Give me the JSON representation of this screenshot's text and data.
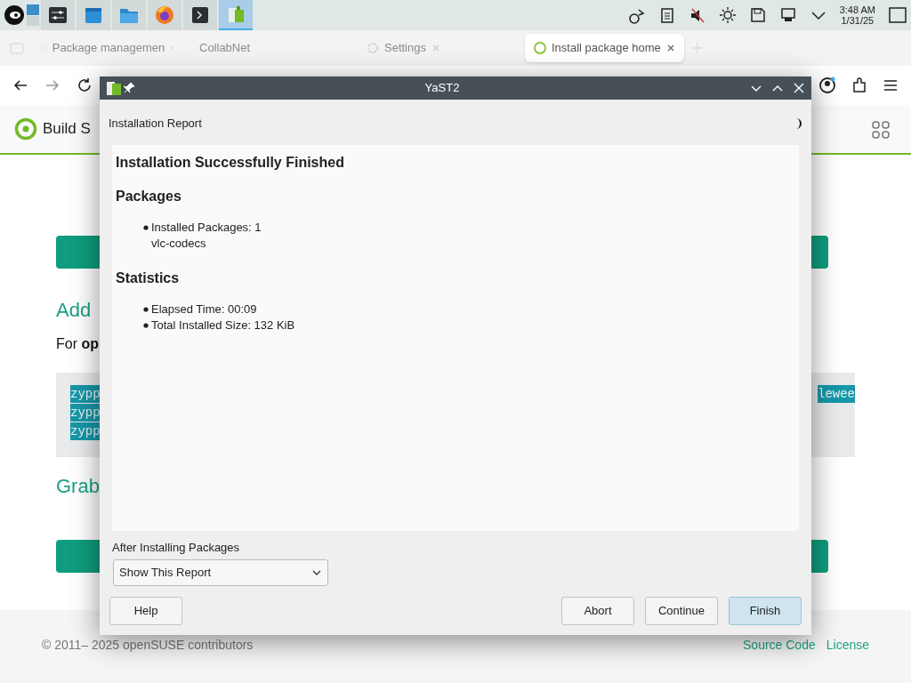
{
  "taskbar": {
    "apps": [
      {
        "selected": false
      },
      {
        "selected": false
      },
      {
        "selected": false
      },
      {
        "selected": false
      },
      {
        "selected": false
      },
      {
        "selected": true
      }
    ],
    "clock": {
      "time": "3:48 AM",
      "date": "1/31/25"
    }
  },
  "browser": {
    "tabs": [
      {
        "label": "Package managemen",
        "selected": false
      },
      {
        "label": "CollabNet",
        "selected": false
      },
      {
        "label": "Settings",
        "selected": false
      },
      {
        "label": "Install package home",
        "selected": true
      }
    ]
  },
  "site": {
    "title": "Build S",
    "heading": "Add",
    "intro": "For **op**",
    "commands": [
      "zypp",
      "zypp",
      "zypp"
    ],
    "command_tail": "lewee",
    "heading2": "Grab",
    "copyright": "© 2011– 2025 openSUSE contributors",
    "links": [
      "Source Code",
      "License"
    ]
  },
  "dialog": {
    "title": "YaST2",
    "subtitle": "Installation Report",
    "heading": "Installation Successfully Finished",
    "sections": [
      {
        "title": "Packages",
        "items": [
          {
            "text": "Installed Packages: 1",
            "detail": "vlc-codecs"
          }
        ]
      },
      {
        "title": "Statistics",
        "items": [
          {
            "text": "Elapsed Time: 00:09"
          },
          {
            "text": "Total Installed Size: 132 KiB"
          }
        ]
      }
    ],
    "after_label": "After Installing Packages",
    "after_value": "Show This Report",
    "buttons": [
      {
        "label": "Help",
        "default": false
      },
      {
        "label": "Abort",
        "default": false
      },
      {
        "label": "Continue",
        "default": false
      },
      {
        "label": "Finish",
        "default": true
      }
    ]
  }
}
